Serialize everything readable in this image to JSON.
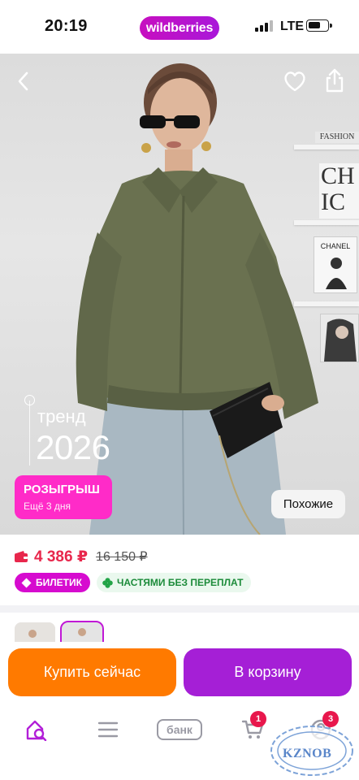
{
  "status_bar": {
    "time": "20:19",
    "brand": "wildberries",
    "network": "LTE"
  },
  "hero": {
    "trend_word": "тренд",
    "trend_year": "2026",
    "promo_title": "РОЗЫГРЫШ",
    "promo_subtitle": "Ещё 3 дня",
    "similar_label": "Похожие",
    "decor_book_label": "FASHION",
    "decor_book_letters": "CH IC",
    "decor_frame_label": "CHANEL"
  },
  "price": {
    "current": "4 386 ₽",
    "old": "16 150 ₽",
    "current_color": "#e8274c"
  },
  "badges": [
    {
      "label": "БИЛЕТИК",
      "icon": "ticket-icon"
    },
    {
      "label": "ЧАСТЯМИ БЕЗ ПЕРЕПЛАТ",
      "icon": "clover-icon"
    }
  ],
  "actions": {
    "buy_now": "Купить сейчас",
    "add_to_cart": "В корзину",
    "buy_color": "#ff7a00",
    "cart_color": "#a51fd6"
  },
  "bottom_nav": {
    "bank_label": "банк",
    "cart_count": "1",
    "profile_count": "3"
  },
  "watermark": "KZNOB"
}
